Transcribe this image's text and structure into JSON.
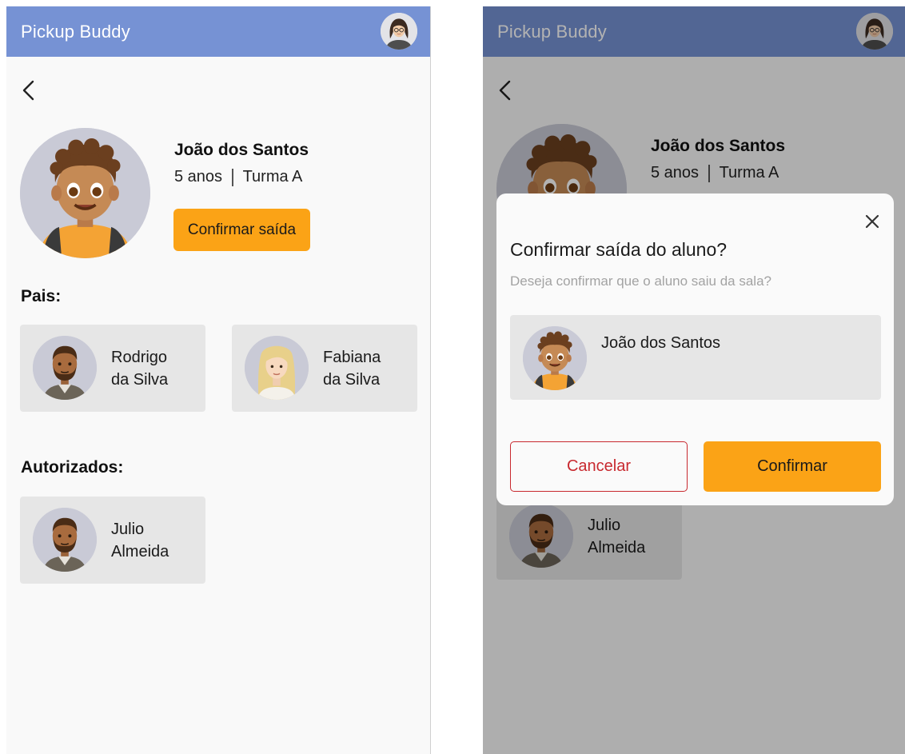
{
  "app": {
    "title": "Pickup Buddy"
  },
  "student": {
    "name": "João dos Santos",
    "age": "5 anos",
    "class": "Turma A"
  },
  "actions": {
    "confirm_exit": "Confirmar saída"
  },
  "sections": {
    "parents": "Pais:",
    "authorized": "Autorizados:"
  },
  "parents": [
    {
      "line1": "Rodrigo",
      "line2": "da Silva"
    },
    {
      "line1": "Fabiana",
      "line2": "da Silva"
    }
  ],
  "authorized": [
    {
      "line1": "Julio",
      "line2": "Almeida"
    }
  ],
  "dialog": {
    "title": "Confirmar saída do aluno?",
    "subtitle": "Deseja confirmar que o aluno saiu da sala?",
    "student_name": "João dos Santos",
    "cancel": "Cancelar",
    "confirm": "Confirmar"
  },
  "icons": {
    "back": "chevron-left-icon",
    "close": "close-icon",
    "user_avatar": "teacher-avatar-icon"
  },
  "colors": {
    "appbar": "#7692d4",
    "accent": "#fba316",
    "cancel_border": "#c8292f",
    "card_bg": "#e6e6e6",
    "avatar_bg": "#c9cad6"
  }
}
